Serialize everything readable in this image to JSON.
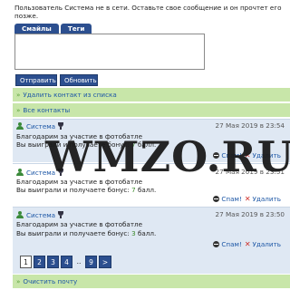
{
  "notice": "Пользователь Система не в сети. Оставьте свое сообщение и он прочтет его позже.",
  "tabs": [
    "Смайлы",
    "Теги"
  ],
  "buttons": {
    "send": "Отправить",
    "refresh": "Обновить"
  },
  "links": {
    "remove_contact": "Удалить контакт из списка",
    "all_contacts": "Все контакты",
    "clear_mail": "Очистить почту"
  },
  "messages": [
    {
      "user": "Система",
      "date": "27 Мая 2019 в 23:54",
      "line1": "Благодарим за участие в фотобатле",
      "line2_prefix": "Вы выиграли и получаете бонус: ",
      "bonus": "7",
      "line2_suffix": " балл.",
      "spam": "Спам!",
      "delete": "Удалить"
    },
    {
      "user": "Система",
      "date": "27 Мая 2019 в 23:51",
      "line1": "Благодарим за участие в фотобатле",
      "line2_prefix": "Вы выиграли и получаете бонус: ",
      "bonus": "7",
      "line2_suffix": " балл.",
      "spam": "Спам!",
      "delete": "Удалить"
    },
    {
      "user": "Система",
      "date": "27 Мая 2019 в 23:50",
      "line1": "Благодарим за участие в фотобатле",
      "line2_prefix": "Вы выиграли и получаете бонус: ",
      "bonus": "3",
      "line2_suffix": " балл.",
      "spam": "Спам!",
      "delete": "Удалить"
    }
  ],
  "pager": [
    "1",
    "2",
    "3",
    "4",
    "..",
    "9",
    ">"
  ],
  "pager_current": "1",
  "watermark": "WMZO.RU",
  "colors": {
    "accent": "#2c4f8f",
    "green_bar": "#c8e6a9",
    "link": "#1d57a6",
    "msg_bg": "#dfe8f3",
    "bonus": "#3a8a2a",
    "delete": "#d0302a"
  },
  "icons": {
    "user": "user-icon",
    "award": "cup-icon",
    "spam": "spam-icon",
    "delete": "delete-x-icon",
    "arrow": "double-chevron-icon"
  }
}
